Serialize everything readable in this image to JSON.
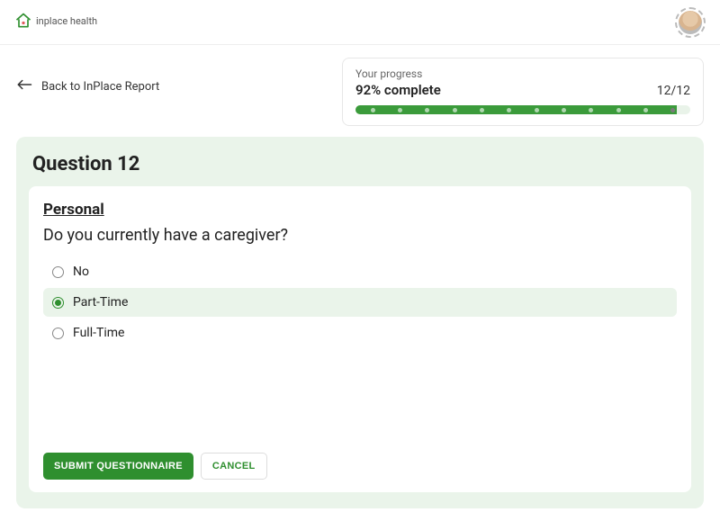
{
  "brand": {
    "name": "inplace health"
  },
  "nav": {
    "back_label": "Back to InPlace Report"
  },
  "progress": {
    "label": "Your progress",
    "percent_text": "92% complete",
    "count_text": "12/12",
    "total_steps": 12,
    "completed_steps": 11
  },
  "question": {
    "heading": "Question 12",
    "category": "Personal",
    "text": "Do you currently have a caregiver?",
    "options": [
      {
        "label": "No",
        "selected": false
      },
      {
        "label": "Part-Time",
        "selected": true
      },
      {
        "label": "Full-Time",
        "selected": false
      }
    ]
  },
  "actions": {
    "submit_label": "SUBMIT QUESTIONNAIRE",
    "cancel_label": "CANCEL"
  },
  "colors": {
    "accent": "#2f8f2f",
    "panel": "#eaf4ea"
  }
}
